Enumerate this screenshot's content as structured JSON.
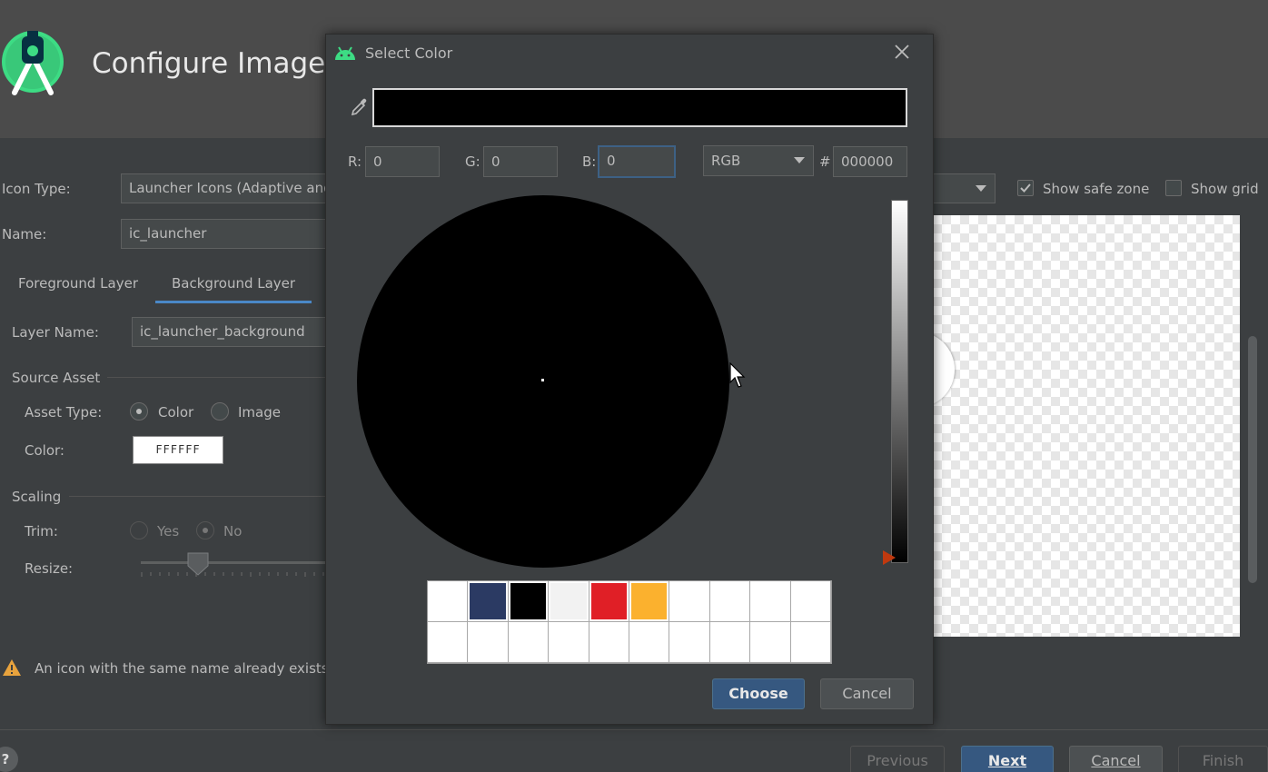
{
  "window": {
    "title": "Configure Image Asset"
  },
  "form": {
    "icon_type_label": "Icon Type:",
    "icon_type_value": "Launcher Icons (Adaptive and Legacy)",
    "name_label": "Name:",
    "name_value": "ic_launcher",
    "tabs": [
      {
        "label": "Foreground Layer",
        "selected": false
      },
      {
        "label": "Background Layer",
        "selected": true
      }
    ],
    "layer_name_label": "Layer Name:",
    "layer_name_value": "ic_launcher_background",
    "source_asset_label": "Source Asset",
    "asset_type_label": "Asset Type:",
    "asset_type_options": [
      {
        "label": "Color",
        "selected": true
      },
      {
        "label": "Image",
        "selected": false
      }
    ],
    "color_label": "Color:",
    "color_value": "FFFFFF",
    "scaling_label": "Scaling",
    "trim_label": "Trim:",
    "trim_options": [
      {
        "label": "Yes",
        "selected": false
      },
      {
        "label": "No",
        "selected": true
      }
    ],
    "resize_label": "Resize:",
    "warning_text": "An icon with the same name already exists"
  },
  "preview": {
    "show_safe_zone_label": "Show safe zone",
    "show_safe_zone_checked": true,
    "show_grid_label": "Show grid",
    "show_grid_checked": false
  },
  "footer": {
    "help_label": "?",
    "previous_label": "Previous",
    "next_label": "Next",
    "cancel_label": "Cancel",
    "finish_label": "Finish"
  },
  "dialog": {
    "title": "Select Color",
    "current_color": "#000000",
    "r_label": "R:",
    "r_value": "0",
    "g_label": "G:",
    "g_value": "0",
    "b_label": "B:",
    "b_value": "0",
    "mode_value": "RGB",
    "hash_label": "#",
    "hex_value": "000000",
    "brightness": 0,
    "recent_colors": [
      "#ffffff",
      "#2b3a63",
      "#000000",
      "#f2f2f2",
      "#e01f26",
      "#fbb12e",
      "#ffffff",
      "#ffffff",
      "#ffffff",
      "#ffffff",
      "#ffffff",
      "#ffffff",
      "#ffffff",
      "#ffffff",
      "#ffffff",
      "#ffffff",
      "#ffffff",
      "#ffffff",
      "#ffffff",
      "#ffffff"
    ],
    "choose_label": "Choose",
    "cancel_label": "Cancel"
  },
  "colors": {
    "accent": "#4a88c7",
    "primary_button": "#365880",
    "brightness_marker": "#c0390f"
  },
  "icons": [
    "android-studio-logo-icon",
    "android-icon",
    "close-icon",
    "eyedropper-icon",
    "warning-icon",
    "chevron-down-icon",
    "mouse-cursor-icon"
  ]
}
